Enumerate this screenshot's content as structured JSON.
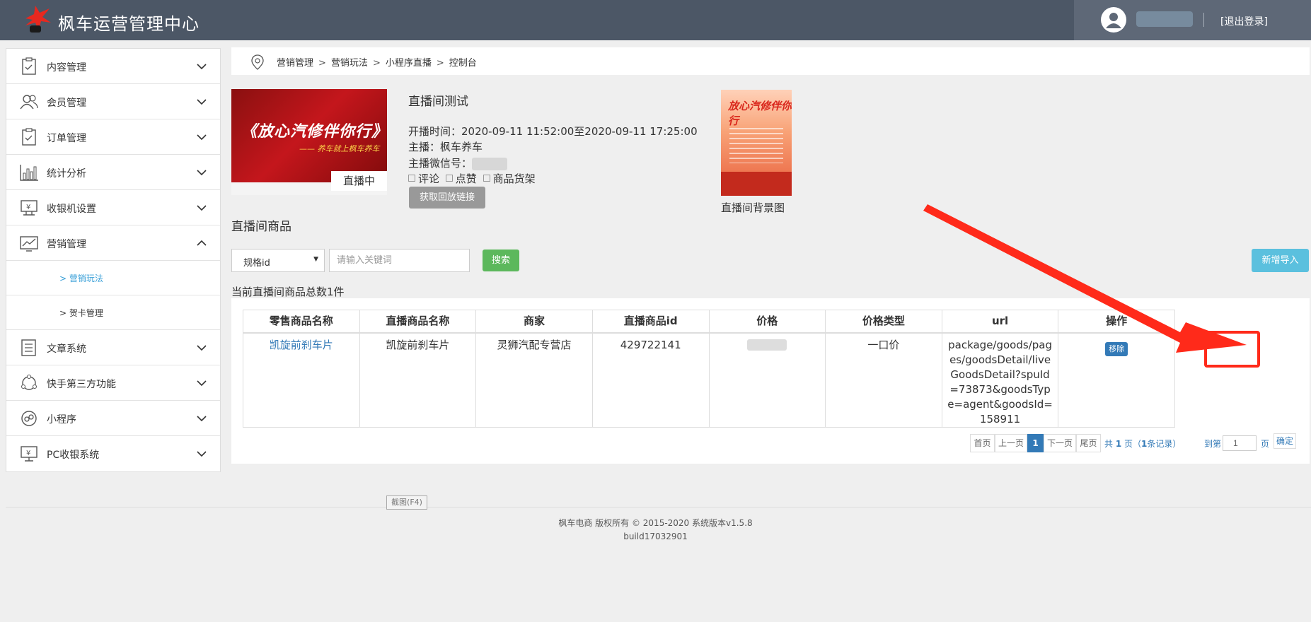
{
  "header": {
    "app_title": "枫车运营管理中心",
    "logout_label": "[退出登录]",
    "colors": {
      "bar": "#4c5766",
      "user_panel": "#5e6877"
    }
  },
  "sidebar": {
    "items": [
      {
        "label": "内容管理",
        "icon": "clipboard-icon"
      },
      {
        "label": "会员管理",
        "icon": "users-icon"
      },
      {
        "label": "订单管理",
        "icon": "order-clipboard-icon"
      },
      {
        "label": "统计分析",
        "icon": "bar-chart-icon"
      },
      {
        "label": "收银机设置",
        "icon": "cash-register-icon"
      },
      {
        "label": "营销管理",
        "icon": "trend-chart-icon",
        "expanded": true
      },
      {
        "label": "文章系统",
        "icon": "article-list-icon"
      },
      {
        "label": "快手第三方功能",
        "icon": "cycle-icon"
      },
      {
        "label": "小程序",
        "icon": "miniprogram-icon"
      },
      {
        "label": "PC收银系统",
        "icon": "pc-cashier-icon"
      }
    ],
    "sub_items": [
      {
        "label": "> 营销玩法",
        "active": true
      },
      {
        "label": "> 贺卡管理",
        "active": false
      }
    ]
  },
  "breadcrumb": {
    "items": [
      "营销管理",
      "营销玩法",
      "小程序直播",
      "控制台"
    ],
    "separator": ">"
  },
  "live_room": {
    "cover_headline": "《放心汽修伴你行》",
    "cover_subline": "—— 养车就上枫车养车",
    "status_badge": "直播中",
    "title": "直播间测试",
    "time_line": "开播时间：2020-09-11 11:52:00至2020-09-11 17:25:00",
    "host_line": "主播：枫车养车",
    "wechat_label": "主播微信号：",
    "options": [
      "评论",
      "点赞",
      "商品货架"
    ],
    "replay_button": "获取回放链接",
    "bg_image_headline": "放心汽修伴你行",
    "bg_image_label": "直播间背景图"
  },
  "goods": {
    "section_title": "直播间商品",
    "filter_select": "规格id",
    "search_placeholder": "请输入关键词",
    "search_button": "搜索",
    "import_button": "新增导入",
    "count_text": "当前直播间商品总数1件",
    "columns": [
      "零售商品名称",
      "直播商品名称",
      "商家",
      "直播商品id",
      "价格",
      "价格类型",
      "url",
      "操作"
    ],
    "rows": [
      {
        "retail_name": "凯旋前刹车片",
        "live_name": "凯旋前刹车片",
        "merchant": "灵狮汽配专营店",
        "live_id": "429722141",
        "price_type": "一口价",
        "url": "package/goods/pages/goodsDetail/liveGoodsDetail?spuId=73873&goodsType=agent&goodsId=158911",
        "action": "移除"
      }
    ]
  },
  "pagination": {
    "first": "首页",
    "prev": "上一页",
    "current": "1",
    "next": "下一页",
    "last": "尾页",
    "summary_prefix": "共",
    "total_pages": "1",
    "summary_mid": "页（",
    "total_records": "1",
    "summary_suffix": "条记录）",
    "goto_label": "到第",
    "goto_value": "1",
    "page_unit": "页",
    "confirm": "确定"
  },
  "footer": {
    "screenshot_tip": "截图(F4)",
    "copyright": "枫车电商 版权所有 © 2015-2020 系统版本v1.5.8",
    "build": "build17032901"
  },
  "annotation": {
    "color": "#ff2a1a"
  }
}
